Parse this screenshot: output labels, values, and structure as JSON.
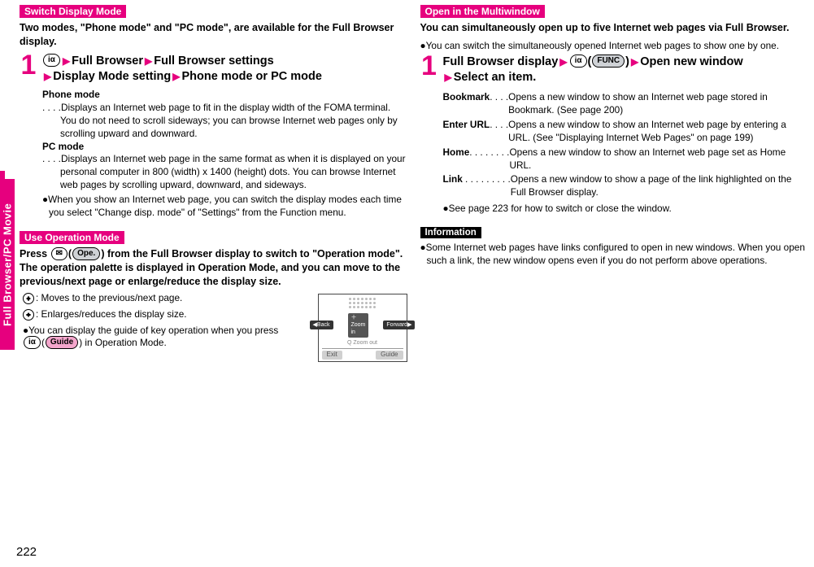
{
  "side_tab": "Full Browser/PC Movie",
  "page_number": "222",
  "left": {
    "sec1": {
      "tag": "Switch Display Mode",
      "lead": "Two modes, \"Phone mode\" and \"PC mode\", are available for the Full Browser display.",
      "step_num": "1",
      "step_icon": "iα",
      "step_a": "Full Browser",
      "step_b": "Full Browser settings",
      "step_c": "Display Mode setting",
      "step_d": "Phone mode or PC mode",
      "phone_label": "Phone mode",
      "phone_desc": ". . . .Displays an Internet web page to fit in the display width of the FOMA terminal. You do not need to scroll sideways; you can browse Internet web pages only by scrolling upward and downward.",
      "pc_label": "PC mode",
      "pc_desc": ". . . .Displays an Internet web page in the same format as when it is displayed on your personal computer in 800 (width) x 1400 (height) dots. You can browse Internet web pages by scrolling upward, downward, and sideways.",
      "bullet": "●When you show an Internet web page, you can switch the display modes each time you select \"Change disp. mode\" of \"Settings\" from the Function menu."
    },
    "sec2": {
      "tag": "Use Operation Mode",
      "lead_a": "Press ",
      "lead_icon1": "✉",
      "lead_b": "(",
      "lead_icon_label": "Ope.",
      "lead_c": ") from the Full Browser display to switch to \"Operation mode\". The operation palette is displayed in Operation Mode, and you can move to the previous/next page or enlarge/reduce the display size.",
      "row1": ": Moves to the previous/next page.",
      "row2": ": Enlarges/reduces the display size.",
      "row3a": "●You can display the guide of key operation when you press ",
      "row3_icon": "iα",
      "row3b": "(",
      "row3_label": "Guide",
      "row3c": ") in Operation Mode.",
      "illus": {
        "back": "◀Back",
        "zoom": "＋Zoom in",
        "fwd": "Forward▶",
        "exit": "Exit",
        "guide": "Guide"
      }
    }
  },
  "right": {
    "sec1": {
      "tag": "Open in the Multiwindow",
      "lead": "You can simultaneously open up to five Internet web pages via Full Browser.",
      "bullet": "●You can switch the simultaneously opened Internet web pages to show one by one.",
      "step_num": "1",
      "step_a": "Full Browser display",
      "step_icon": "iα",
      "step_func": "FUNC",
      "step_c": "Open new window",
      "step_d": "Select an item.",
      "defs": [
        {
          "term": "Bookmark",
          "dots": ". . . .",
          "def": "Opens a new window to show an Internet web page stored in Bookmark. (See page 200)"
        },
        {
          "term": "Enter URL",
          "dots": ". . . .",
          "def": "Opens a new window to show an Internet web page by entering a URL. (See \"Displaying Internet Web Pages\" on page 199)"
        },
        {
          "term": "Home",
          "dots": ". . . . . . . .",
          "def": "Opens a new window to show an Internet web page set as Home URL."
        },
        {
          "term": "Link",
          "dots": " . . . . . . . . .",
          "def": "Opens a new window to show a page of the link highlighted on the Full Browser display."
        }
      ],
      "post_bullet": "●See page 223 for how to switch or close the window."
    },
    "info": {
      "tag": "Information",
      "body": "●Some Internet web pages have links configured to open in new windows. When you open such a link, the new window opens even if you do not perform above operations."
    }
  }
}
